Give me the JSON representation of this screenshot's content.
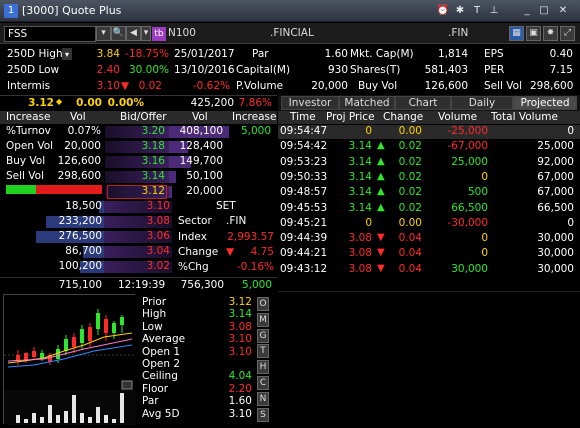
{
  "window": {
    "title": "[3000] Quote Plus",
    "badge": "1"
  },
  "titlebar_icons": [
    "alarm-icon",
    "settings-icon",
    "text-icon",
    "pin-icon",
    "minimize-icon",
    "maximize-icon",
    "close-icon"
  ],
  "toolbar": {
    "symbol": "FSS",
    "sector_code": "N100",
    "sector_name": ".FINCIAL",
    "index_name": ".FIN",
    "tb_label": "tb"
  },
  "info": {
    "r1": {
      "label": "250D High",
      "v1": "3.84",
      "v2": "-18.75%",
      "v3": "25/01/2017",
      "l2": "Par",
      "v4": "1.60",
      "l3": "Mkt. Cap(M)",
      "v5": "1,814",
      "l4": "EPS",
      "v6": "0.40"
    },
    "r2": {
      "label": "250D Low",
      "v1": "2.40",
      "v2": "30.00%",
      "v3": "13/10/2016",
      "l2": "Capital(M)",
      "v4": "930",
      "l3": "Shares(T)",
      "v5": "581,403",
      "l4": "PER",
      "v6": "7.15"
    },
    "r3": {
      "label": "Intermis",
      "v1": "3.10",
      "v2": "0.02",
      "v3": "-0.62%",
      "l2": "P.Volume",
      "v4": "20,000",
      "l3": "Buy Vol",
      "v5": "126,600",
      "l4": "Sell Vol",
      "v6": "298,600"
    }
  },
  "quote": {
    "last": "3.12",
    "change": "0.00",
    "pct": "0.00%",
    "volume": "425,200",
    "pct2": "7.86%"
  },
  "left_stats": {
    "headers": [
      "Increase",
      "Vol",
      "Bid/Offer",
      "Vol",
      "Increase"
    ],
    "rows": [
      {
        "label": "%Turnov",
        "value": "0.07%"
      },
      {
        "label": "Open Vol",
        "value": "20,000"
      },
      {
        "label": "Buy Vol",
        "value": "126,600"
      },
      {
        "label": "Sell Vol",
        "value": "298,600"
      }
    ],
    "last_increase": "5,000"
  },
  "offers": [
    {
      "price": "3.20",
      "vol": "408,100",
      "fill": 1.0
    },
    {
      "price": "3.18",
      "vol": "128,400",
      "fill": 0.32
    },
    {
      "price": "3.16",
      "vol": "149,700",
      "fill": 0.37
    },
    {
      "price": "3.14",
      "vol": "50,100",
      "fill": 0.12
    },
    {
      "price": "3.12",
      "vol": "20,000",
      "fill": 0.05
    }
  ],
  "bids": [
    {
      "price": "3.10",
      "vol": "18,500",
      "fill": 0.07
    },
    {
      "price": "3.08",
      "vol": "233,200",
      "fill": 0.85
    },
    {
      "price": "3.06",
      "vol": "276,500",
      "fill": 1.0
    },
    {
      "price": "3.04",
      "vol": "86,700",
      "fill": 0.31
    },
    {
      "price": "3.02",
      "vol": "100,200",
      "fill": 0.36
    }
  ],
  "set_info": {
    "title": "SET",
    "sector_label": "Sector",
    "sector_value": ".FIN",
    "index_label": "Index",
    "index_value": "2,993.57",
    "change_label": "Change",
    "change_value": "4.75",
    "pchg_label": "%Chg",
    "pchg_value": "-0.16%"
  },
  "totals": {
    "bid_total": "715,100",
    "time": "12:19:39",
    "offer_total": "756,300",
    "extra": "5,000"
  },
  "tabs": [
    {
      "label": "Investor"
    },
    {
      "label": "Matched"
    },
    {
      "label": "Chart"
    },
    {
      "label": "Daily"
    },
    {
      "label": "Projected"
    }
  ],
  "projected": {
    "headers": [
      "Time",
      "Proj Price",
      "Change",
      "Volume",
      "Total Volume"
    ],
    "rows": [
      {
        "time": "09:54:47",
        "price": "0",
        "change": "0.00",
        "volume": "-25,000",
        "total": "0",
        "dir": "none"
      },
      {
        "time": "09:54:42",
        "price": "3.14",
        "change": "0.02",
        "volume": "-67,000",
        "total": "25,000",
        "dir": "up"
      },
      {
        "time": "09:53:23",
        "price": "3.14",
        "change": "0.02",
        "volume": "25,000",
        "total": "92,000",
        "dir": "up"
      },
      {
        "time": "09:50:33",
        "price": "3.14",
        "change": "0.02",
        "volume": "0",
        "total": "67,000",
        "dir": "up"
      },
      {
        "time": "09:48:57",
        "price": "3.14",
        "change": "0.02",
        "volume": "500",
        "total": "67,000",
        "dir": "up"
      },
      {
        "time": "09:45:53",
        "price": "3.14",
        "change": "0.02",
        "volume": "66,500",
        "total": "66,500",
        "dir": "up"
      },
      {
        "time": "09:45:21",
        "price": "0",
        "change": "0.00",
        "volume": "-30,000",
        "total": "0",
        "dir": "none"
      },
      {
        "time": "09:44:39",
        "price": "3.08",
        "change": "0.04",
        "volume": "0",
        "total": "30,000",
        "dir": "down"
      },
      {
        "time": "09:44:21",
        "price": "3.08",
        "change": "0.04",
        "volume": "0",
        "total": "30,000",
        "dir": "down"
      },
      {
        "time": "09:43:12",
        "price": "3.08",
        "change": "0.04",
        "volume": "30,000",
        "total": "30,000",
        "dir": "down"
      }
    ]
  },
  "bottom_stats": [
    {
      "label": "Prior",
      "value": "3.12",
      "color": "#ffd200"
    },
    {
      "label": "High",
      "value": "3.14",
      "color": "#2ee62e"
    },
    {
      "label": "Low",
      "value": "3.08",
      "color": "#ff2a2a"
    },
    {
      "label": "Average",
      "value": "3.10",
      "color": "#ff2a2a"
    },
    {
      "label": "Open 1",
      "value": "3.10",
      "color": "#ff2a2a"
    },
    {
      "label": "Open 2",
      "value": "",
      "color": "#fff"
    },
    {
      "label": "Ceiling",
      "value": "4.04",
      "color": "#2ee62e"
    },
    {
      "label": "Floor",
      "value": "2.20",
      "color": "#ff2a2a"
    },
    {
      "label": "Par",
      "value": "1.60",
      "color": "#fff"
    },
    {
      "label": "Avg 5D",
      "value": "3.10",
      "color": "#fff"
    }
  ],
  "side_letters": [
    "O",
    "M",
    "G",
    "T",
    "H",
    "C",
    "N",
    "S"
  ]
}
